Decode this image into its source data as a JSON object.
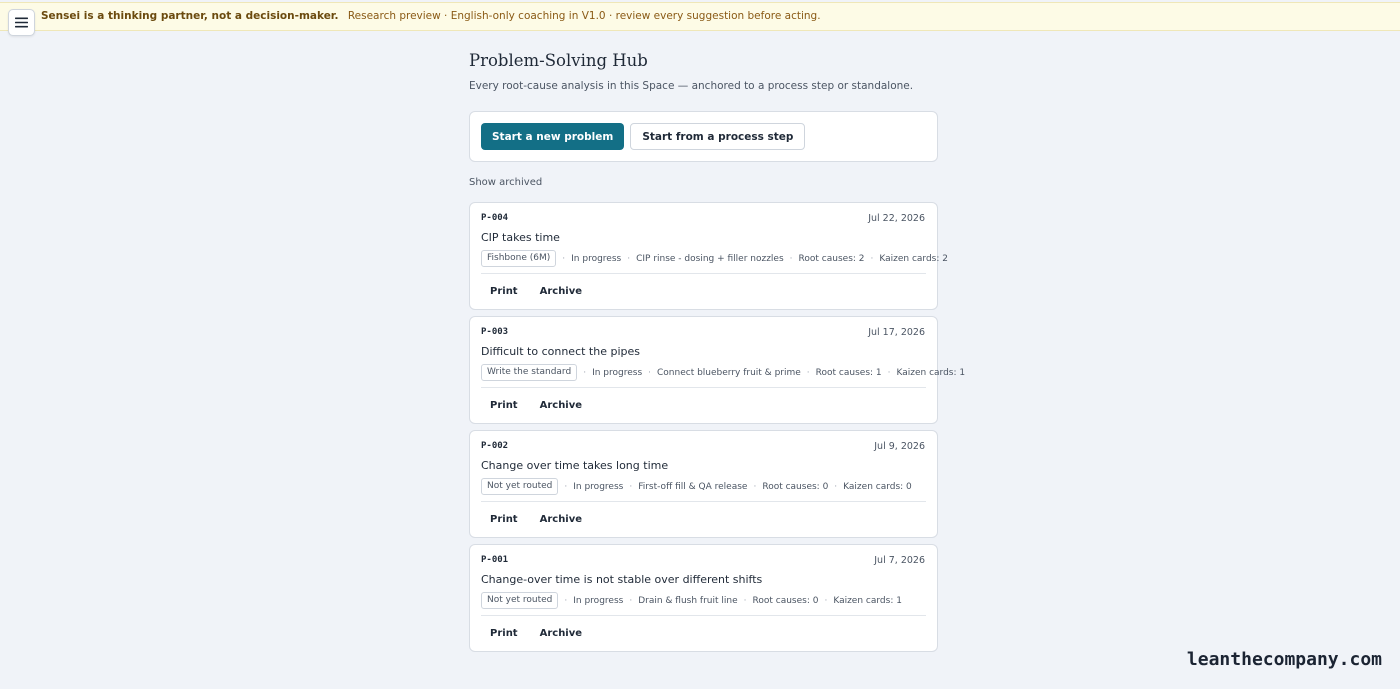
{
  "banner": {
    "strong": "Sensei is a thinking partner, not a decision-maker.",
    "rest": "Research preview · English-only coaching in V1.0 · review every suggestion before acting."
  },
  "menu": {
    "icon": "hamburger-menu-icon"
  },
  "header": {
    "title": "Problem-Solving Hub",
    "subtitle": "Every root-cause analysis in this Space — anchored to a process step or standalone."
  },
  "actions": {
    "primary_label": "Start a new problem",
    "secondary_label": "Start from a process step"
  },
  "filter": {
    "show_archived_label": "Show archived"
  },
  "problems": [
    {
      "id": "P-004",
      "date": "Jul 22, 2026",
      "title": "CIP takes time",
      "tag": "Fishbone (6M)",
      "status": "In progress",
      "step": "CIP rinse - dosing + filler nozzles",
      "root_causes": "Root causes: 2",
      "kaizen_cards": "Kaizen cards: 2",
      "print_label": "Print",
      "archive_label": "Archive"
    },
    {
      "id": "P-003",
      "date": "Jul 17, 2026",
      "title": "Difficult to connect the pipes",
      "tag": "Write the standard",
      "status": "In progress",
      "step": "Connect blueberry fruit & prime",
      "root_causes": "Root causes: 1",
      "kaizen_cards": "Kaizen cards: 1",
      "print_label": "Print",
      "archive_label": "Archive"
    },
    {
      "id": "P-002",
      "date": "Jul 9, 2026",
      "title": "Change over time takes long time",
      "tag": "Not yet routed",
      "status": "In progress",
      "step": "First-off fill & QA release",
      "root_causes": "Root causes: 0",
      "kaizen_cards": "Kaizen cards: 0",
      "print_label": "Print",
      "archive_label": "Archive"
    },
    {
      "id": "P-001",
      "date": "Jul 7, 2026",
      "title": "Change-over time is not stable over different shifts",
      "tag": "Not yet routed",
      "status": "In progress",
      "step": "Drain & flush fruit line",
      "root_causes": "Root causes: 0",
      "kaizen_cards": "Kaizen cards: 1",
      "print_label": "Print",
      "archive_label": "Archive"
    }
  ],
  "watermark": "leanthecompany.com",
  "colors": {
    "primary": "#136f86",
    "banner_bg": "#fdfbe6",
    "page_bg": "#f0f3f8"
  }
}
